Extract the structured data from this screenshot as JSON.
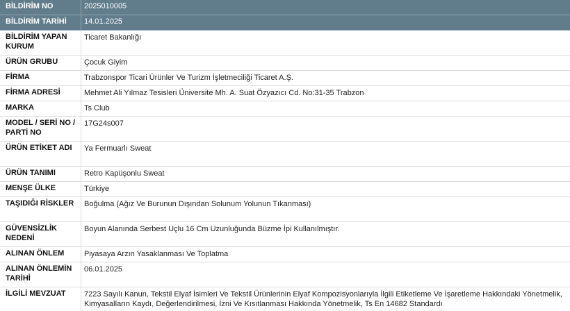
{
  "rows": [
    {
      "label": "BİLDİRİM NO",
      "value": "2025010005"
    },
    {
      "label": "BİLDİRİM TARİHİ",
      "value": "14.01.2025"
    },
    {
      "label": "BİLDİRİM YAPAN KURUM",
      "value": "Ticaret Bakanlığı"
    },
    {
      "label": "ÜRÜN GRUBU",
      "value": "Çocuk Giyim"
    },
    {
      "label": "FİRMA",
      "value": "Trabzonspor Ticari Ürünler Ve Turizm İşletmeciliği Ticaret A.Ş."
    },
    {
      "label": "FİRMA ADRESİ",
      "value": "Mehmet Ali Yılmaz Tesisleri Üniversite Mh. A. Suat Özyazıcı Cd. No:31-35 Trabzon"
    },
    {
      "label": "MARKA",
      "value": "Ts Club"
    },
    {
      "label": "MODEL / SERİ NO / PARTİ NO",
      "value": "17G24s007"
    },
    {
      "label": "ÜRÜN ETİKET ADI",
      "value": "Ya Fermuarlı Sweat"
    },
    {
      "label": "ÜRÜN TANIMI",
      "value": "Retro Kapüşonlu Sweat"
    },
    {
      "label": "MENŞE ÜLKE",
      "value": "Türkiye"
    },
    {
      "label": "TAŞIDIĞI RİSKLER",
      "value": "Boğulma (Ağız Ve Burunun Dışından Solunum Yolunun Tıkanması)"
    },
    {
      "label": "GÜVENSİZLİK NEDENİ",
      "value": "Boyun Alanında Serbest Uçlu 16 Cm Uzunluğunda Büzme İpi Kullanılmıştır."
    },
    {
      "label": "ALINAN ÖNLEM",
      "value": "Piyasaya Arzın Yasaklanması Ve Toplatma"
    },
    {
      "label": "ALINAN ÖNLEMİN TARİHİ",
      "value": "06.01.2025"
    },
    {
      "label": "İLGİLİ MEVZUAT",
      "value": "7223 Sayılı Kanun, Tekstil Elyaf İsimleri Ve Tekstil Ürünlerinin Elyaf Kompozisyonlarıyla İlgili Etiketleme Ve İşaretleme Hakkındaki Yönetmelik, Kimyasalların Kaydı, Değerlendirilmesi, İzni Ve Kısıtlanması Hakkında Yönetmelik, Ts En 14682 Standardı"
    }
  ]
}
